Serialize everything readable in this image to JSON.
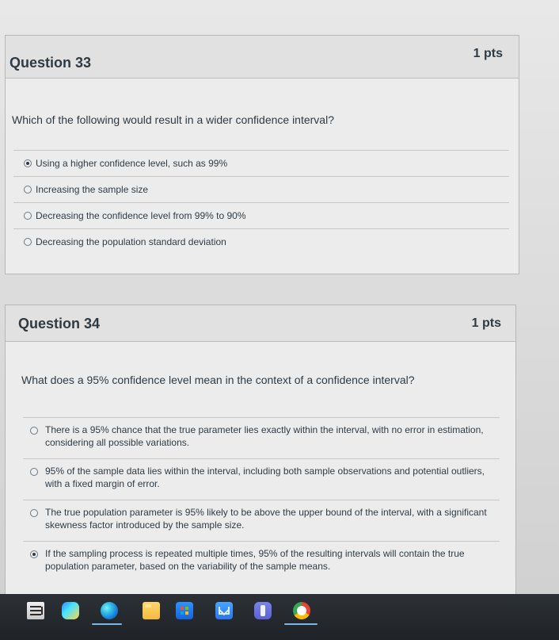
{
  "questions": [
    {
      "title": "Question 33",
      "points": "1 pts",
      "prompt": "Which of the following would result in a wider confidence interval?",
      "options": [
        {
          "label": "Using a higher confidence level, such as 99%",
          "selected": true
        },
        {
          "label": "Increasing the sample size",
          "selected": false
        },
        {
          "label": "Decreasing the confidence level from 99% to 90%",
          "selected": false
        },
        {
          "label": "Decreasing the population standard deviation",
          "selected": false
        }
      ]
    },
    {
      "title": "Question 34",
      "points": "1 pts",
      "prompt": "What does a 95% confidence level mean in the context of a confidence interval?",
      "options": [
        {
          "label": "There is a 95% chance that the true parameter lies exactly within the interval, with no error in estimation, considering all possible variations.",
          "selected": false
        },
        {
          "label": "95% of the sample data lies within the interval, including both sample observations and potential outliers, with a fixed margin of error.",
          "selected": false
        },
        {
          "label": "The true population parameter is 95% likely to be above the upper bound of the interval, with a significant skewness factor introduced by the sample size.",
          "selected": false
        },
        {
          "label": "If the sampling process is repeated multiple times, 95% of the resulting intervals will contain the true population parameter, based on the variability of the sample means.",
          "selected": true
        }
      ]
    }
  ],
  "taskbar": {
    "icons": [
      "task-view-icon",
      "gradient-app-icon",
      "edge-icon",
      "folder-icon",
      "store-icon",
      "mail-icon",
      "teams-icon",
      "chrome-icon"
    ],
    "active_underlines": [
      "edge-icon",
      "chrome-icon"
    ]
  },
  "colors": {
    "page_background": "#d9d9d9",
    "card_background": "#e9e9e9",
    "text": "#2d3b45",
    "divider": "#c7c7c7",
    "taskbar": "#1f2327",
    "taskbar_active": "#7bb6ea"
  }
}
